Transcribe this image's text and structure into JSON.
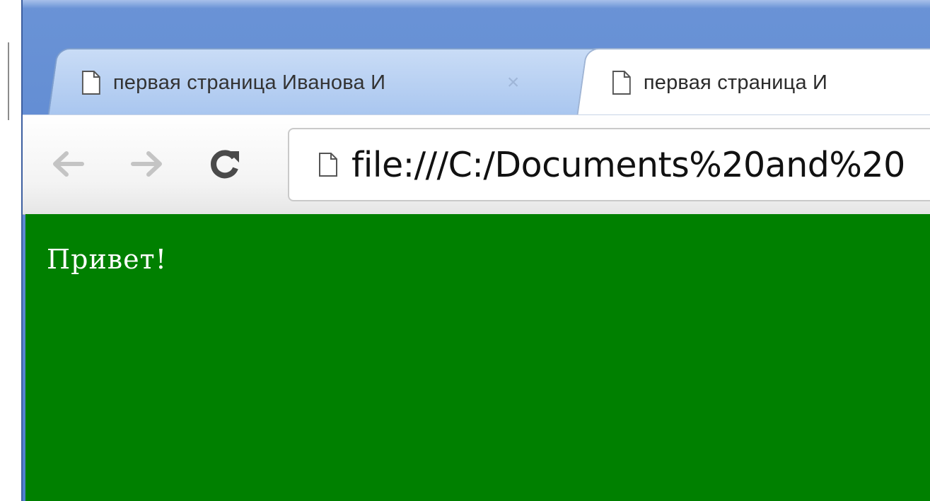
{
  "tabs": [
    {
      "title": "первая страница Иванова И",
      "close_glyph": "×",
      "icon": "page-icon",
      "active": false
    },
    {
      "title": "первая страница И",
      "icon": "page-icon",
      "active": true
    }
  ],
  "toolbar": {
    "back_icon": "arrow-left-icon",
    "forward_icon": "arrow-right-icon",
    "reload_icon": "reload-icon"
  },
  "omnibox": {
    "url": "file:///C:/Documents%20and%20",
    "icon": "page-icon"
  },
  "page": {
    "text": "Привет!",
    "background_color": "#008000",
    "text_color": "#ffffff"
  }
}
